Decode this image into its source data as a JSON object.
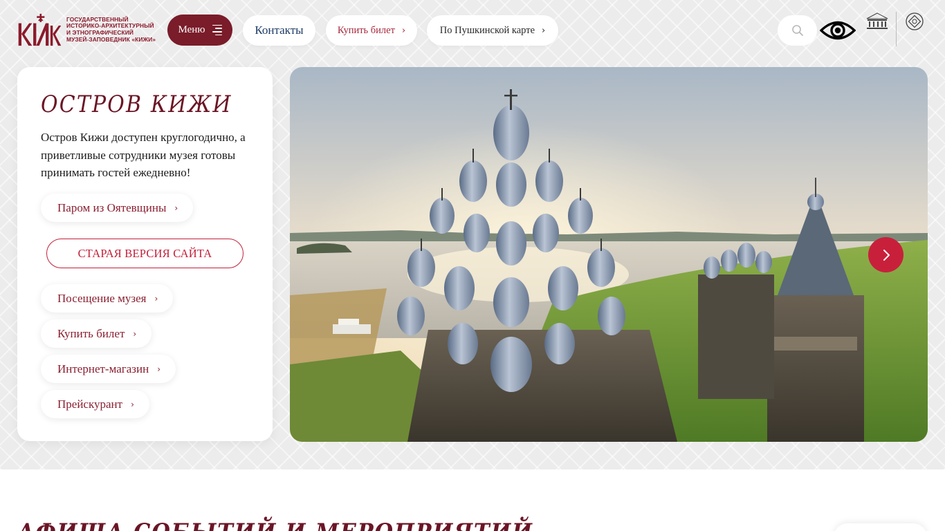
{
  "header": {
    "logo": {
      "mark_text": "КИЖИ",
      "lines": [
        "Государственный",
        "историко-архитектурный",
        "и этнографический",
        "музей-заповедник «Кижи»"
      ]
    },
    "menu_label": "Меню",
    "nav": {
      "contacts_label": "Контакты",
      "buy_ticket_label": "Купить билет",
      "pushkin_card_label": "По Пушкинской карте"
    }
  },
  "card": {
    "title": "Остров Кижи",
    "description": "Остров Кижи доступен круглогодично, а приветливые сотрудники музея готовы принимать гостей ежедневно!",
    "ferry_label": "Паром из Оятевщины",
    "old_site_label": "СТАРАЯ ВЕРСИЯ САЙТА",
    "links": {
      "visit": "Посещение музея",
      "buy": "Купить билет",
      "shop": "Интернет-магазин",
      "prices": "Прейскурант"
    }
  },
  "bottom": {
    "heading": "Афиша событий и мероприятий"
  },
  "colors": {
    "brand": "#7a1c2a",
    "accent": "#c8203b",
    "link": "#8a1f30",
    "contacts": "#1d3a66",
    "page_bg": "#ececec"
  },
  "icons": {
    "menu": "hamburger-icon",
    "chevron": "chevron-right-icon",
    "search": "search-icon",
    "vision": "eye-icon",
    "next": "arrow-right-icon"
  }
}
